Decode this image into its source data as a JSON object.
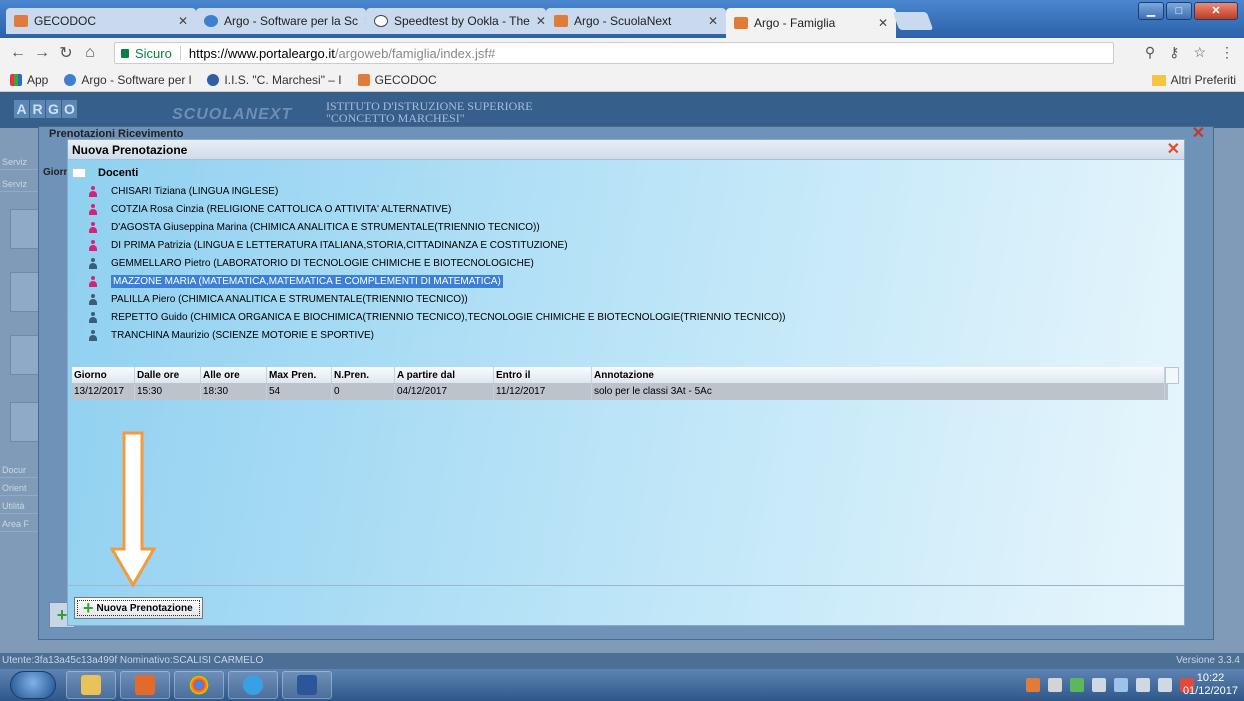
{
  "browser": {
    "tabs": [
      {
        "label": "GECODOC",
        "color": "#e07b39"
      },
      {
        "label": "Argo - Software per la Sc",
        "color": "#3e7fd0"
      },
      {
        "label": "Speedtest by Ookla - The",
        "color": "#444444"
      },
      {
        "label": "Argo - ScuolaNext",
        "color": "#e07b39"
      },
      {
        "label": "Argo - Famiglia",
        "color": "#e07b39"
      }
    ],
    "secure_label": "Sicuro",
    "url_host": "https://www.portaleargo.it",
    "url_path": "/argoweb/famiglia/index.jsf#",
    "bookmarks": [
      "App",
      "Argo - Software per l",
      "I.I.S. \"C. Marchesi\" – I",
      "GECODOC"
    ],
    "other_bookmarks": "Altri Preferiti"
  },
  "app": {
    "logo_letters": [
      "A",
      "R",
      "G",
      "O"
    ],
    "product": "SCUOLANEXT",
    "institute_line1": "ISTITUTO D'ISTRUZIONE SUPERIORE",
    "institute_line2": "\"CONCETTO MARCHESI\"",
    "left_menu": [
      "Serviz",
      "Serviz",
      "Docur",
      "Orient",
      "Utilità",
      "Area F"
    ],
    "status_user": "Utente:3fa13a45c13a499f Nominativo:SCALISI CARMELO",
    "version": "Versione 3.3.4"
  },
  "outer_dialog": {
    "title": "Prenotazioni Ricevimento",
    "giorno": "Giorn"
  },
  "dialog": {
    "title": "Nuova Prenotazione",
    "tree_root": "Docenti",
    "teachers": [
      {
        "name": "CHISARI Tiziana (LINGUA INGLESE)",
        "gender": "f"
      },
      {
        "name": "COTZIA Rosa Cinzia (RELIGIONE CATTOLICA O ATTIVITA' ALTERNATIVE)",
        "gender": "f"
      },
      {
        "name": "D'AGOSTA Giuseppina Marina (CHIMICA ANALITICA E STRUMENTALE(TRIENNIO TECNICO))",
        "gender": "f"
      },
      {
        "name": "DI PRIMA Patrizia (LINGUA E LETTERATURA ITALIANA,STORIA,CITTADINANZA E COSTITUZIONE)",
        "gender": "f"
      },
      {
        "name": "GEMMELLARO Pietro (LABORATORIO DI TECNOLOGIE CHIMICHE E BIOTECNOLOGICHE)",
        "gender": "m"
      },
      {
        "name": "MAZZONE MARIA (MATEMATICA,MATEMATICA E COMPLEMENTI DI MATEMATICA)",
        "gender": "f",
        "selected": true
      },
      {
        "name": "PALILLA Piero (CHIMICA ANALITICA E STRUMENTALE(TRIENNIO TECNICO))",
        "gender": "m"
      },
      {
        "name": "REPETTO Guido (CHIMICA ORGANICA E BIOCHIMICA(TRIENNIO TECNICO),TECNOLOGIE CHIMICHE E BIOTECNOLOGIE(TRIENNIO TECNICO))",
        "gender": "m"
      },
      {
        "name": "TRANCHINA Maurizio (SCIENZE MOTORIE E SPORTIVE)",
        "gender": "m"
      }
    ],
    "columns": [
      "Giorno",
      "Dalle ore",
      "Alle ore",
      "Max Pren.",
      "N.Pren.",
      "A partire dal",
      "Entro il",
      "Annotazione"
    ],
    "rows": [
      [
        "13/12/2017",
        "15:30",
        "18:30",
        "54",
        "0",
        "04/12/2017",
        "11/12/2017",
        "solo per le classi 3At - 5Ac"
      ]
    ],
    "button_label": "Nuova Prenotazione"
  },
  "taskbar": {
    "time": "10:22",
    "date": "01/12/2017"
  },
  "colors": {
    "accent_arrow": "#f39a3d",
    "selection": "#3b7fd6",
    "female_icon": "#d4247a",
    "male_icon": "#3e5b7c"
  }
}
